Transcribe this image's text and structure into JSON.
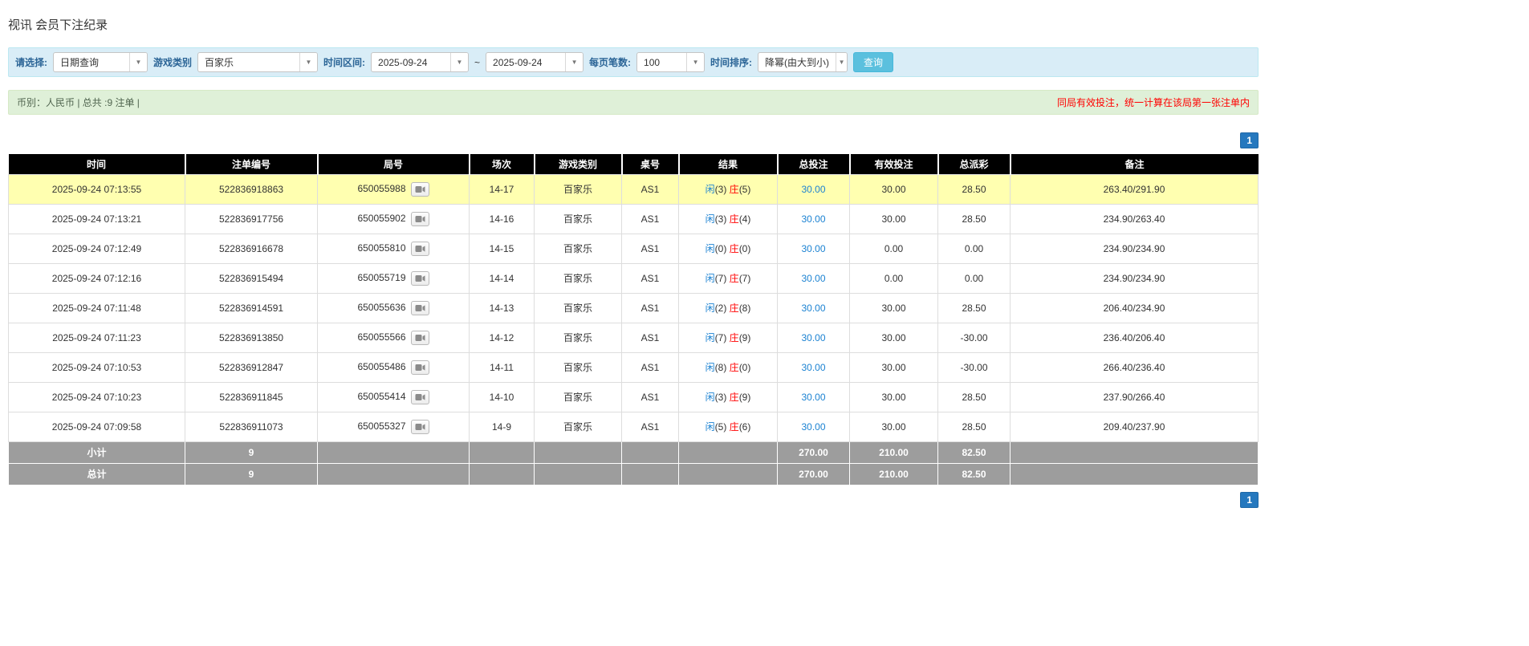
{
  "title": "视讯 会员下注纪录",
  "filters": {
    "select_label": "请选择:",
    "select_value": "日期查询",
    "game_type_label": "游戏类别",
    "game_type_value": "百家乐",
    "date_range_label": "时间区间:",
    "date_from": "2025-09-24",
    "date_separator": "~",
    "date_to": "2025-09-24",
    "page_size_label": "每页笔数:",
    "page_size_value": "100",
    "sort_label": "时间排序:",
    "sort_value": "降幂(由大到小)",
    "search_button": "查询"
  },
  "summary": {
    "info": "币别：人民币 | 总共 :9 注单 |",
    "note": "同局有效投注，统一计算在该局第一张注单内"
  },
  "pagination": {
    "page": "1"
  },
  "table": {
    "headers": [
      "时间",
      "注单编号",
      "局号",
      "场次",
      "游戏类别",
      "桌号",
      "结果",
      "总投注",
      "有效投注",
      "总派彩",
      "备注"
    ],
    "result_labels": {
      "player": "闲",
      "banker": "庄"
    },
    "rows": [
      {
        "time": "2025-09-24 07:13:55",
        "bet_id": "522836918863",
        "round_id": "650055988",
        "session": "14-17",
        "game": "百家乐",
        "table_no": "AS1",
        "player": "3",
        "banker": "5",
        "total_bet": "30.00",
        "valid_bet": "30.00",
        "payout": "28.50",
        "remark": "263.40/291.90",
        "highlight": true
      },
      {
        "time": "2025-09-24 07:13:21",
        "bet_id": "522836917756",
        "round_id": "650055902",
        "session": "14-16",
        "game": "百家乐",
        "table_no": "AS1",
        "player": "3",
        "banker": "4",
        "total_bet": "30.00",
        "valid_bet": "30.00",
        "payout": "28.50",
        "remark": "234.90/263.40",
        "highlight": false
      },
      {
        "time": "2025-09-24 07:12:49",
        "bet_id": "522836916678",
        "round_id": "650055810",
        "session": "14-15",
        "game": "百家乐",
        "table_no": "AS1",
        "player": "0",
        "banker": "0",
        "total_bet": "30.00",
        "valid_bet": "0.00",
        "payout": "0.00",
        "remark": "234.90/234.90",
        "highlight": false
      },
      {
        "time": "2025-09-24 07:12:16",
        "bet_id": "522836915494",
        "round_id": "650055719",
        "session": "14-14",
        "game": "百家乐",
        "table_no": "AS1",
        "player": "7",
        "banker": "7",
        "total_bet": "30.00",
        "valid_bet": "0.00",
        "payout": "0.00",
        "remark": "234.90/234.90",
        "highlight": false
      },
      {
        "time": "2025-09-24 07:11:48",
        "bet_id": "522836914591",
        "round_id": "650055636",
        "session": "14-13",
        "game": "百家乐",
        "table_no": "AS1",
        "player": "2",
        "banker": "8",
        "total_bet": "30.00",
        "valid_bet": "30.00",
        "payout": "28.50",
        "remark": "206.40/234.90",
        "highlight": false
      },
      {
        "time": "2025-09-24 07:11:23",
        "bet_id": "522836913850",
        "round_id": "650055566",
        "session": "14-12",
        "game": "百家乐",
        "table_no": "AS1",
        "player": "7",
        "banker": "9",
        "total_bet": "30.00",
        "valid_bet": "30.00",
        "payout": "-30.00",
        "remark": "236.40/206.40",
        "highlight": false
      },
      {
        "time": "2025-09-24 07:10:53",
        "bet_id": "522836912847",
        "round_id": "650055486",
        "session": "14-11",
        "game": "百家乐",
        "table_no": "AS1",
        "player": "8",
        "banker": "0",
        "total_bet": "30.00",
        "valid_bet": "30.00",
        "payout": "-30.00",
        "remark": "266.40/236.40",
        "highlight": false
      },
      {
        "time": "2025-09-24 07:10:23",
        "bet_id": "522836911845",
        "round_id": "650055414",
        "session": "14-10",
        "game": "百家乐",
        "table_no": "AS1",
        "player": "3",
        "banker": "9",
        "total_bet": "30.00",
        "valid_bet": "30.00",
        "payout": "28.50",
        "remark": "237.90/266.40",
        "highlight": false
      },
      {
        "time": "2025-09-24 07:09:58",
        "bet_id": "522836911073",
        "round_id": "650055327",
        "session": "14-9",
        "game": "百家乐",
        "table_no": "AS1",
        "player": "5",
        "banker": "6",
        "total_bet": "30.00",
        "valid_bet": "30.00",
        "payout": "28.50",
        "remark": "209.40/237.90",
        "highlight": false
      }
    ],
    "subtotal": {
      "label": "小计",
      "count": "9",
      "total_bet": "270.00",
      "valid_bet": "210.00",
      "payout": "82.50"
    },
    "total": {
      "label": "总计",
      "count": "9",
      "total_bet": "270.00",
      "valid_bet": "210.00",
      "payout": "82.50"
    }
  }
}
